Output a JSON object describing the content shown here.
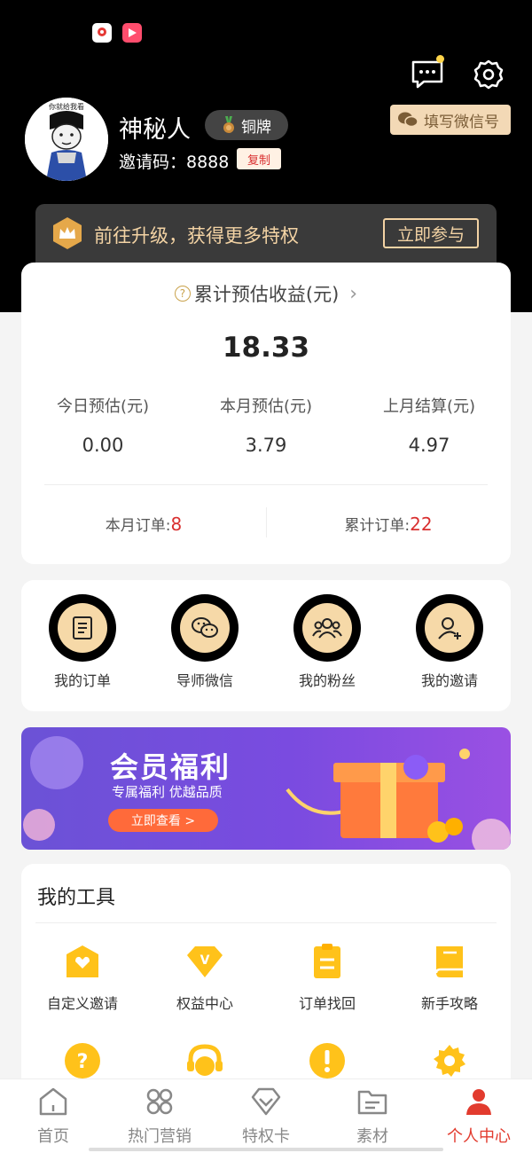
{
  "status_bar": {
    "icons": [
      "map-app-icon",
      "video-app-icon"
    ]
  },
  "header": {
    "wechat_tip": "填写微信号",
    "username": "神秘人",
    "badge": "铜牌",
    "invite_label": "邀请码：8888",
    "copy_label": "复制",
    "avatar_caption": "你就给我看"
  },
  "upgrade": {
    "text": "前往升级，获得更多特权",
    "button": "立即参与"
  },
  "earnings": {
    "title": "累计预估收益(元)",
    "total": "18.33",
    "stats": [
      {
        "label": "今日预估(元)",
        "value": "0.00"
      },
      {
        "label": "本月预估(元)",
        "value": "3.79"
      },
      {
        "label": "上月结算(元)",
        "value": "4.97"
      }
    ],
    "orders": [
      {
        "label": "本月订单:",
        "value": "8"
      },
      {
        "label": "累计订单:",
        "value": "22"
      }
    ]
  },
  "quick_actions": [
    {
      "label": "我的订单",
      "icon": "order-list-icon"
    },
    {
      "label": "导师微信",
      "icon": "wechat-icon"
    },
    {
      "label": "我的粉丝",
      "icon": "fans-icon"
    },
    {
      "label": "我的邀请",
      "icon": "invite-user-icon"
    }
  ],
  "banner": {
    "title": "会员福利",
    "subtitle": "专属福利 优越品质",
    "button": "立即查看 >"
  },
  "tools": {
    "title": "我的工具",
    "items": [
      {
        "label": "自定义邀请",
        "icon": "custom-invite-icon"
      },
      {
        "label": "权益中心",
        "icon": "vip-diamond-icon"
      },
      {
        "label": "订单找回",
        "icon": "order-recover-icon"
      },
      {
        "label": "新手攻略",
        "icon": "guide-book-icon"
      },
      {
        "label": "",
        "icon": "help-icon"
      },
      {
        "label": "",
        "icon": "service-headset-icon"
      },
      {
        "label": "",
        "icon": "alert-icon"
      },
      {
        "label": "",
        "icon": "settings-gear-icon"
      }
    ]
  },
  "tabbar": {
    "tabs": [
      {
        "label": "首页",
        "icon": "home-icon"
      },
      {
        "label": "热门营销",
        "icon": "grid-icon"
      },
      {
        "label": "特权卡",
        "icon": "diamond-icon"
      },
      {
        "label": "素材",
        "icon": "folder-icon"
      },
      {
        "label": "个人中心",
        "icon": "person-icon"
      }
    ],
    "active_index": 4
  },
  "colors": {
    "accent": "#e23b2e",
    "gold": "#f3d3a4",
    "tool_yellow": "#ffc21a",
    "banner_purple": "#7a4be0"
  }
}
